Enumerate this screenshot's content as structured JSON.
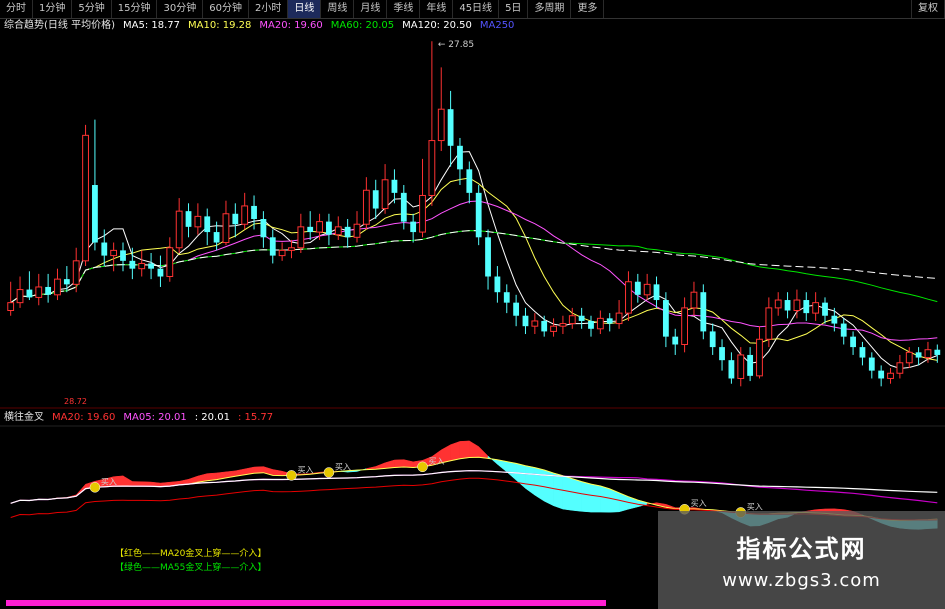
{
  "tabs": [
    "分时",
    "1分钟",
    "5分钟",
    "15分钟",
    "30分钟",
    "60分钟",
    "2小时",
    "日线",
    "周线",
    "月线",
    "季线",
    "年线",
    "45日线",
    "5日",
    "多周期",
    "更多"
  ],
  "active_tab": "日线",
  "right_tab": "复权",
  "main_legend": {
    "title": "综合趋势(日线 平均价格)",
    "ma5": "MA5: 18.77",
    "ma10": "MA10: 19.28",
    "ma20": "MA20: 19.60",
    "ma60": "MA60: 20.05",
    "ma120": "MA120: 20.50",
    "ma250": "MA250"
  },
  "high_label": "27.85",
  "low_tag": "28.72",
  "sub_legend": {
    "title": "横往金叉",
    "ma20": "MA20: 19.60",
    "ma05": "MA05: 20.01",
    "val3": ": 20.01",
    "val4": ": 15.77"
  },
  "notes": [
    {
      "text": "【红色——MA20金叉上穿——介入】",
      "color": "#e6e600"
    },
    {
      "text": "【绿色——MA55金叉上穿——介入】",
      "color": "#00e600"
    }
  ],
  "cross_label": "买入",
  "watermark": {
    "title": "指标公式网",
    "url": "www.zbgs3.com"
  },
  "colors": {
    "up": "#ff3232",
    "down": "#54ffff",
    "ma5": "#ffffff",
    "ma10": "#ffff54",
    "ma20": "#ff54ff",
    "ma60": "#00e600",
    "ma120": "#ffffff",
    "ma250": "#5454ff"
  },
  "chart_data": {
    "type": "candlestick",
    "price_range": [
      14,
      28
    ],
    "candles": [
      [
        17.5,
        17.8,
        18.6,
        17.3
      ],
      [
        17.8,
        18.3,
        18.8,
        17.6
      ],
      [
        18.3,
        18.0,
        19.0,
        17.9
      ],
      [
        18.0,
        18.4,
        18.9,
        17.7
      ],
      [
        18.4,
        18.1,
        18.9,
        17.8
      ],
      [
        18.1,
        18.7,
        19.1,
        17.9
      ],
      [
        18.7,
        18.5,
        19.2,
        18.2
      ],
      [
        18.5,
        19.4,
        19.9,
        18.2
      ],
      [
        19.4,
        24.2,
        24.6,
        19.2
      ],
      [
        22.3,
        20.1,
        24.8,
        19.8
      ],
      [
        20.1,
        19.6,
        20.6,
        19.2
      ],
      [
        19.6,
        19.8,
        20.1,
        19.0
      ],
      [
        19.8,
        19.4,
        20.1,
        19.0
      ],
      [
        19.4,
        19.1,
        19.9,
        18.7
      ],
      [
        19.1,
        19.3,
        19.8,
        18.8
      ],
      [
        19.3,
        19.1,
        19.7,
        18.7
      ],
      [
        19.1,
        18.8,
        19.6,
        18.4
      ],
      [
        18.8,
        19.9,
        20.3,
        18.6
      ],
      [
        19.9,
        21.3,
        21.8,
        19.7
      ],
      [
        21.3,
        20.7,
        21.6,
        20.3
      ],
      [
        20.7,
        21.1,
        21.6,
        20.4
      ],
      [
        21.1,
        20.5,
        21.4,
        20.0
      ],
      [
        20.5,
        20.1,
        20.9,
        19.8
      ],
      [
        20.1,
        21.2,
        21.7,
        20.0
      ],
      [
        21.2,
        20.8,
        21.6,
        20.3
      ],
      [
        20.8,
        21.5,
        22.0,
        20.6
      ],
      [
        21.5,
        21.0,
        21.9,
        20.6
      ],
      [
        21.0,
        20.3,
        21.3,
        19.9
      ],
      [
        20.3,
        19.6,
        20.6,
        19.3
      ],
      [
        19.6,
        19.8,
        20.1,
        19.4
      ],
      [
        19.8,
        19.9,
        20.2,
        19.5
      ],
      [
        19.9,
        20.7,
        21.2,
        19.7
      ],
      [
        20.7,
        20.5,
        21.3,
        20.2
      ],
      [
        20.5,
        20.9,
        21.2,
        20.2
      ],
      [
        20.9,
        20.4,
        21.2,
        20.0
      ],
      [
        20.4,
        20.7,
        21.1,
        20.2
      ],
      [
        20.7,
        20.3,
        21.0,
        19.9
      ],
      [
        20.3,
        20.8,
        21.3,
        20.1
      ],
      [
        20.8,
        22.1,
        22.6,
        20.6
      ],
      [
        22.1,
        21.4,
        22.5,
        21.0
      ],
      [
        21.4,
        22.5,
        23.1,
        21.2
      ],
      [
        22.5,
        22.0,
        22.9,
        21.6
      ],
      [
        22.0,
        20.9,
        22.3,
        20.6
      ],
      [
        20.9,
        20.5,
        21.2,
        20.1
      ],
      [
        20.5,
        21.9,
        23.3,
        20.3
      ],
      [
        21.9,
        24.0,
        27.8,
        21.5
      ],
      [
        24.0,
        25.2,
        26.8,
        23.6
      ],
      [
        25.2,
        23.8,
        25.9,
        23.0
      ],
      [
        23.8,
        22.9,
        24.1,
        22.3
      ],
      [
        22.9,
        22.0,
        23.2,
        21.6
      ],
      [
        22.0,
        20.3,
        22.3,
        20.0
      ],
      [
        20.3,
        18.8,
        20.6,
        18.3
      ],
      [
        18.8,
        18.2,
        19.2,
        17.8
      ],
      [
        18.2,
        17.8,
        18.5,
        17.4
      ],
      [
        17.8,
        17.3,
        18.1,
        16.9
      ],
      [
        17.3,
        16.9,
        17.6,
        16.6
      ],
      [
        16.9,
        17.1,
        17.4,
        16.6
      ],
      [
        17.1,
        16.7,
        17.3,
        16.5
      ],
      [
        16.7,
        16.9,
        17.2,
        16.5
      ],
      [
        16.9,
        17.0,
        17.3,
        16.6
      ],
      [
        17.0,
        17.3,
        17.6,
        16.8
      ],
      [
        17.3,
        17.1,
        17.6,
        16.8
      ],
      [
        17.1,
        16.8,
        17.3,
        16.5
      ],
      [
        16.8,
        17.2,
        17.5,
        16.6
      ],
      [
        17.2,
        17.0,
        17.4,
        16.7
      ],
      [
        17.0,
        17.4,
        17.9,
        16.8
      ],
      [
        17.4,
        18.6,
        19.0,
        17.1
      ],
      [
        18.6,
        18.1,
        18.9,
        17.8
      ],
      [
        18.1,
        18.5,
        18.9,
        17.9
      ],
      [
        18.5,
        17.9,
        18.8,
        17.6
      ],
      [
        17.9,
        16.5,
        18.2,
        16.1
      ],
      [
        16.5,
        16.2,
        16.8,
        15.8
      ],
      [
        16.2,
        17.6,
        18.0,
        15.9
      ],
      [
        17.6,
        18.2,
        18.6,
        17.3
      ],
      [
        18.2,
        16.7,
        18.5,
        16.4
      ],
      [
        16.7,
        16.1,
        17.0,
        15.8
      ],
      [
        16.1,
        15.6,
        16.4,
        15.2
      ],
      [
        15.6,
        14.9,
        15.9,
        14.7
      ],
      [
        14.9,
        15.8,
        16.1,
        14.6
      ],
      [
        15.8,
        15.0,
        16.1,
        14.8
      ],
      [
        15.0,
        16.4,
        16.9,
        14.9
      ],
      [
        16.4,
        17.6,
        18.0,
        16.1
      ],
      [
        17.6,
        17.9,
        18.2,
        17.3
      ],
      [
        17.9,
        17.5,
        18.2,
        17.2
      ],
      [
        17.5,
        17.9,
        18.3,
        17.2
      ],
      [
        17.9,
        17.4,
        18.2,
        17.1
      ],
      [
        17.4,
        17.8,
        18.2,
        17.1
      ],
      [
        17.8,
        17.3,
        18.0,
        17.0
      ],
      [
        17.3,
        17.0,
        17.6,
        16.7
      ],
      [
        17.0,
        16.5,
        17.2,
        16.2
      ],
      [
        16.5,
        16.1,
        16.7,
        15.8
      ],
      [
        16.1,
        15.7,
        16.3,
        15.4
      ],
      [
        15.7,
        15.2,
        15.9,
        14.9
      ],
      [
        15.2,
        14.9,
        15.4,
        14.6
      ],
      [
        14.9,
        15.1,
        15.3,
        14.7
      ],
      [
        15.1,
        15.5,
        15.8,
        14.9
      ],
      [
        15.5,
        15.9,
        16.1,
        15.3
      ],
      [
        15.9,
        15.7,
        16.1,
        15.4
      ],
      [
        15.7,
        16.0,
        16.3,
        15.5
      ],
      [
        16.0,
        15.8,
        16.2,
        15.5
      ]
    ],
    "ma_series": [
      {
        "name": "MA5",
        "period": 5
      },
      {
        "name": "MA10",
        "period": 10
      },
      {
        "name": "MA20",
        "period": 20
      },
      {
        "name": "MA60",
        "period": 60
      },
      {
        "name": "MA120",
        "period": 120
      }
    ]
  }
}
